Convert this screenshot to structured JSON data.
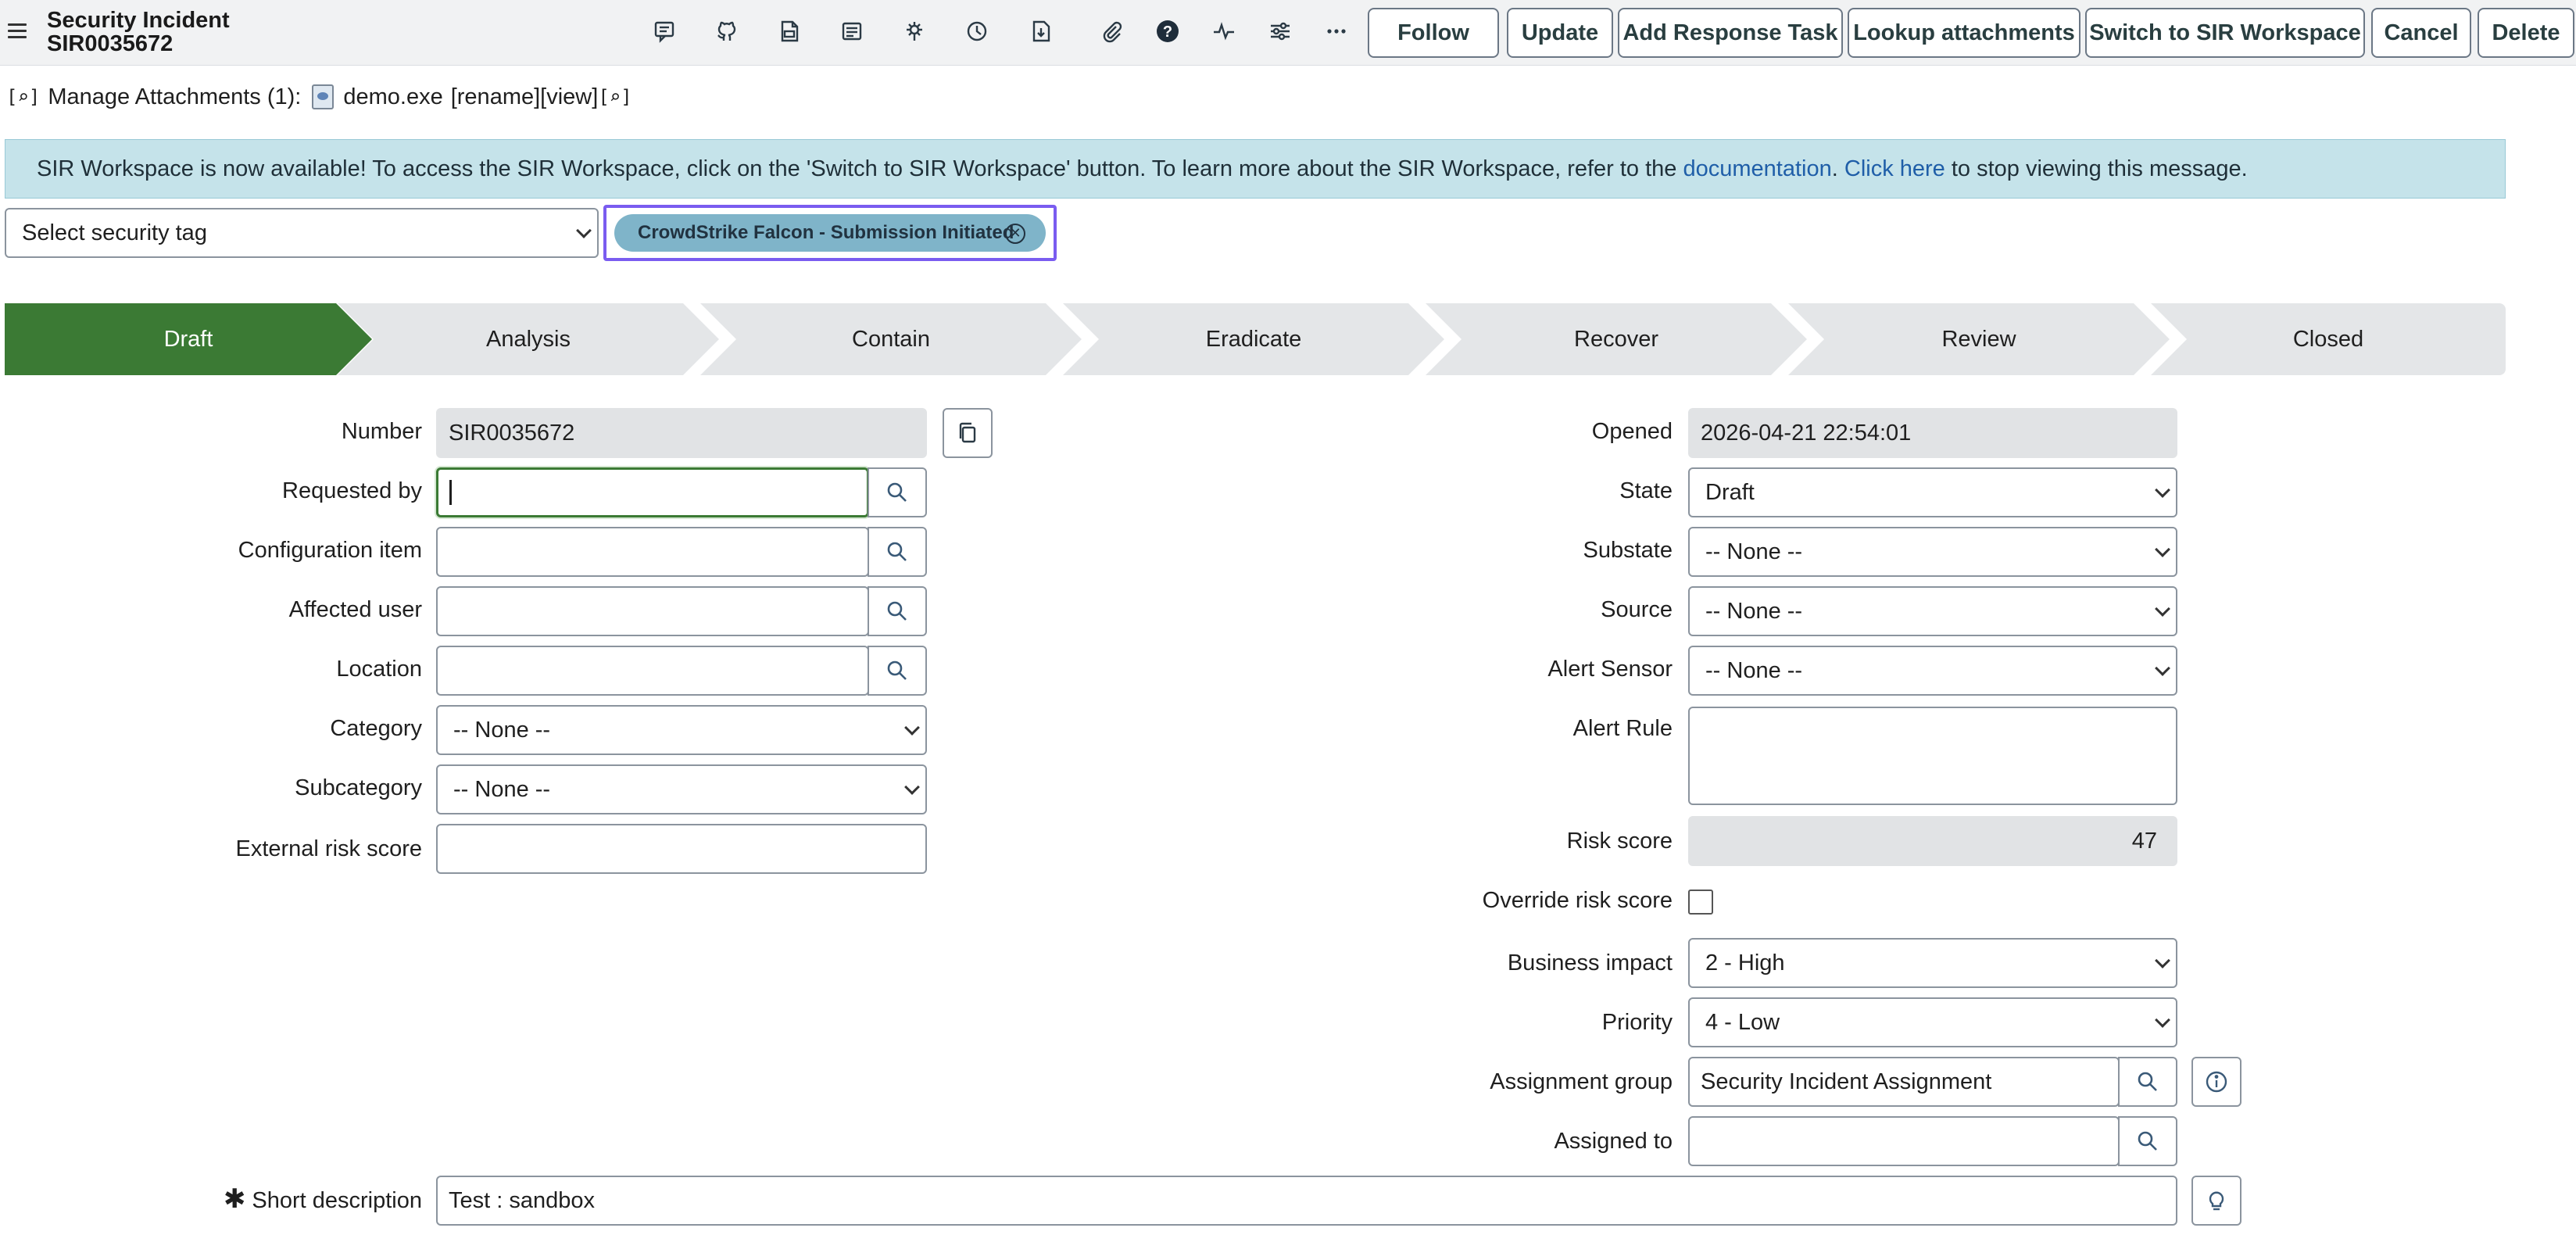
{
  "header": {
    "record_type": "Security Incident",
    "record_number": "SIR0035672",
    "icons": [
      "comment-icon",
      "github-icon",
      "document-icon",
      "list-icon",
      "settings-icon",
      "history-icon",
      "download-icon",
      "paperclip-icon",
      "help-icon",
      "activity-icon",
      "sliders-icon",
      "more-icon"
    ],
    "buttons": {
      "follow": "Follow",
      "update": "Update",
      "add_response_task": "Add Response Task",
      "lookup_attachments": "Lookup attachments",
      "switch_workspace": "Switch to SIR Workspace",
      "cancel": "Cancel",
      "delete": "Delete"
    }
  },
  "attachments": {
    "label": "Manage Attachments (1):",
    "file_name": "demo.exe",
    "rename": "[rename]",
    "view": "[view]"
  },
  "banner": {
    "text_before": "SIR Workspace is now available! To access the SIR Workspace, click on the 'Switch to SIR Workspace' button. To learn more about the SIR Workspace, refer to the ",
    "doc_link": "documentation",
    "separator": ". ",
    "click_here": "Click here",
    "text_after": " to stop viewing this message."
  },
  "tags": {
    "select_placeholder": "Select security tag",
    "chip_label": "CrowdStrike Falcon - Submission Initiated"
  },
  "process_flow": {
    "stages": [
      "Draft",
      "Analysis",
      "Contain",
      "Eradicate",
      "Recover",
      "Review",
      "Closed"
    ],
    "active_stage": "Draft"
  },
  "form": {
    "left": {
      "number": {
        "label": "Number",
        "value": "SIR0035672"
      },
      "requested_by": {
        "label": "Requested by",
        "value": ""
      },
      "configuration_item": {
        "label": "Configuration item",
        "value": ""
      },
      "affected_user": {
        "label": "Affected user",
        "value": ""
      },
      "location": {
        "label": "Location",
        "value": ""
      },
      "category": {
        "label": "Category",
        "value": "-- None --"
      },
      "subcategory": {
        "label": "Subcategory",
        "value": "-- None --"
      },
      "external_risk_score": {
        "label": "External risk score",
        "value": ""
      }
    },
    "right": {
      "opened": {
        "label": "Opened",
        "value": "2026-04-21 22:54:01"
      },
      "state": {
        "label": "State",
        "value": "Draft"
      },
      "substate": {
        "label": "Substate",
        "value": "-- None --"
      },
      "source": {
        "label": "Source",
        "value": "-- None --"
      },
      "alert_sensor": {
        "label": "Alert Sensor",
        "value": "-- None --"
      },
      "alert_rule": {
        "label": "Alert Rule",
        "value": ""
      },
      "risk_score": {
        "label": "Risk score",
        "value": "47"
      },
      "override_risk_score": {
        "label": "Override risk score",
        "checked": false
      },
      "business_impact": {
        "label": "Business impact",
        "value": "2 - High"
      },
      "priority": {
        "label": "Priority",
        "value": "4 - Low"
      },
      "assignment_group": {
        "label": "Assignment group",
        "value": "Security Incident Assignment"
      },
      "assigned_to": {
        "label": "Assigned to",
        "value": ""
      }
    },
    "short_description": {
      "label": "Short description",
      "value": "Test : sandbox",
      "required_mark": "✱"
    }
  },
  "colors": {
    "active_stage": "#3b7a34",
    "inactive_stage": "#e4e6e8",
    "banner_bg": "#c5e3ea",
    "tag_chip": "#7fb4c9",
    "highlight_frame": "#7a5cf0"
  }
}
